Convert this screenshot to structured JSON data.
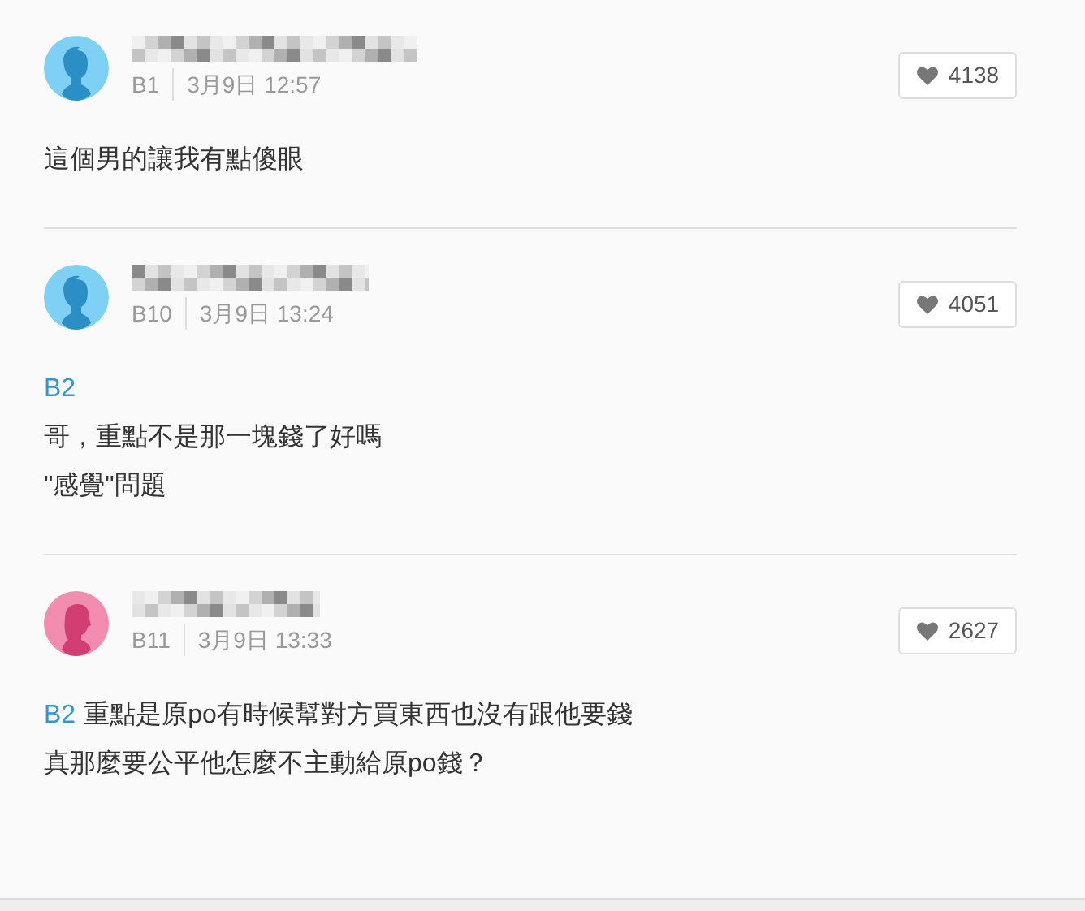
{
  "comments": [
    {
      "avatar": {
        "kind": "male"
      },
      "floor": "B1",
      "time": "3月9日 12:57",
      "likes": "4138",
      "lines": [
        {
          "text": "這個男的讓我有點傻眼"
        }
      ]
    },
    {
      "avatar": {
        "kind": "male"
      },
      "floor": "B10",
      "time": "3月9日 13:24",
      "likes": "4051",
      "lines": [
        {
          "mention": "B2"
        },
        {
          "text": "哥，重點不是那一塊錢了好嗎"
        },
        {
          "text": "\"感覺\"問題"
        }
      ]
    },
    {
      "avatar": {
        "kind": "female"
      },
      "floor": "B11",
      "time": "3月9日 13:33",
      "likes": "2627",
      "lines": [
        {
          "mention": "B2",
          "text": "重點是原po有時候幫對方買東西也沒有跟他要錢"
        },
        {
          "text": "真那麼要公平他怎麼不主動給原po錢？"
        }
      ]
    }
  ]
}
